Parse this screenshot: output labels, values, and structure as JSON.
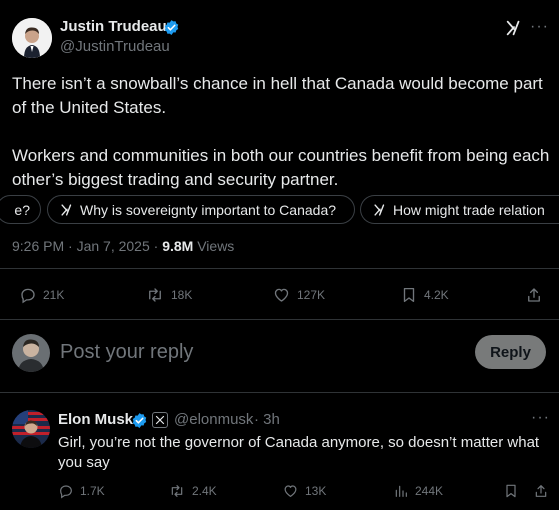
{
  "main_tweet": {
    "author_name": "Justin Trudeau",
    "author_handle": "@JustinTrudeau",
    "grok_icon": "grok-icon",
    "text_p1_l1": "There isn’t a snowball’s chance in hell that Canada would become part",
    "text_p1_l2": "of the United States.",
    "text_p2_l1": "Workers and communities in both our countries benefit from being each",
    "text_p2_l2": "other’s biggest trading and security partner.",
    "grok_chips": [
      "e?",
      "Why is sovereignty important to Canada?",
      "How might trade relation"
    ],
    "timestamp": "9:26 PM · Jan 7, 2025 ·",
    "views_count": "9.8M",
    "views_label": "Views",
    "stats": {
      "replies": "21K",
      "reposts": "18K",
      "likes": "127K",
      "bookmarks": "4.2K"
    }
  },
  "reply_box": {
    "placeholder": "Post your reply",
    "button_label": "Reply"
  },
  "reply_tweet": {
    "author_name": "Elon Musk",
    "author_handle": "@elonmusk",
    "time": "· 3h",
    "more": "···",
    "text_l1": "Girl, you’re not the governor of Canada anymore, so doesn’t matter what",
    "text_l2": "you say",
    "stats": {
      "replies": "1.7K",
      "reposts": "2.4K",
      "likes": "13K",
      "views": "244K"
    }
  },
  "colors": {
    "background": "#000000",
    "text": "#e7e9ea",
    "muted": "#71767b",
    "verified": "#1d9bf0",
    "divider": "#2f3336"
  }
}
